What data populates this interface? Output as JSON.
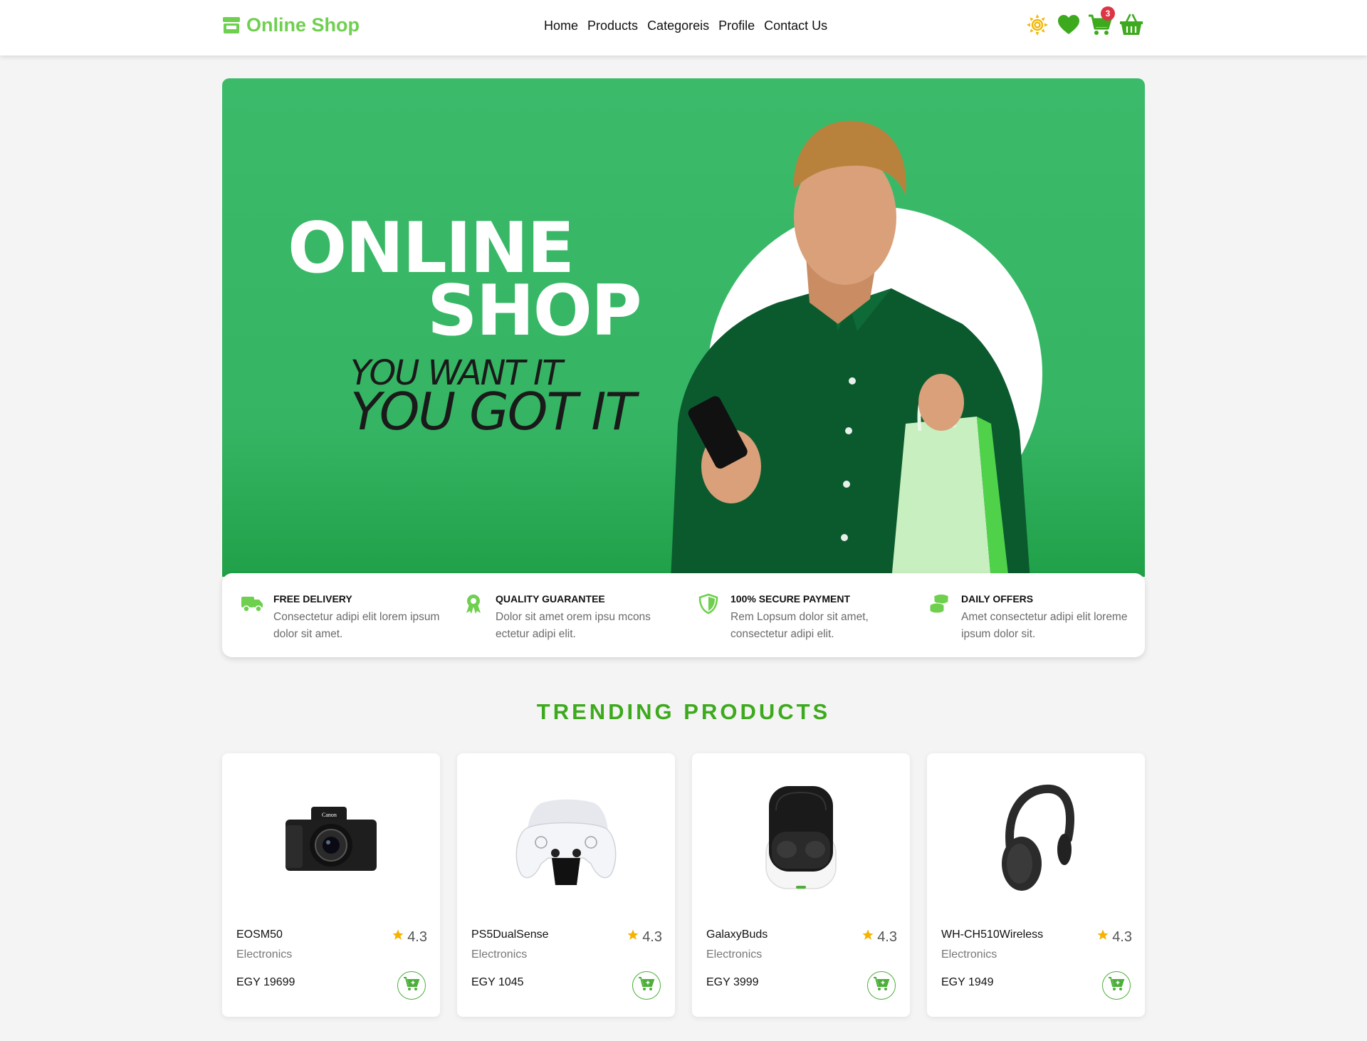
{
  "brand": {
    "name": "Online Shop",
    "color": "#6fcf4f",
    "icon": "store-icon"
  },
  "nav": {
    "links": [
      "Home",
      "Products",
      "Categoreis",
      "Profile",
      "Contact Us"
    ],
    "icons": {
      "theme": "sun-icon",
      "wishlist": "heart-icon",
      "cart": "cart-icon",
      "cart_count": "3",
      "basket": "basket-icon"
    }
  },
  "hero": {
    "title_line1": "ONLINE",
    "title_line2": "SHOP",
    "subtitle_line1": "YOU WANT IT",
    "subtitle_line2": "YOU GOT IT",
    "bg_color": "#3bbb6a"
  },
  "features": [
    {
      "icon": "truck-icon",
      "title": "FREE DELIVERY",
      "desc": "Consectetur adipi elit lorem ipsum dolor sit amet."
    },
    {
      "icon": "award-icon",
      "title": "QUALITY GUARANTEE",
      "desc": "Dolor sit amet orem ipsu mcons ectetur adipi elit."
    },
    {
      "icon": "shield-icon",
      "title": "100% SECURE PAYMENT",
      "desc": "Rem Lopsum dolor sit amet, consectetur adipi elit."
    },
    {
      "icon": "coins-icon",
      "title": "DAILY OFFERS",
      "desc": "Amet consectetur adipi elit loreme ipsum dolor sit."
    }
  ],
  "trending": {
    "title": "TRENDING PRODUCTS",
    "products": [
      {
        "name": "EOSM50",
        "category": "Electronics",
        "price": "EGY 19699",
        "rating": "4.3",
        "image": "camera"
      },
      {
        "name": "PS5DualSense",
        "category": "Electronics",
        "price": "EGY 1045",
        "rating": "4.3",
        "image": "controllers"
      },
      {
        "name": "GalaxyBuds",
        "category": "Electronics",
        "price": "EGY 3999",
        "rating": "4.3",
        "image": "earbuds"
      },
      {
        "name": "WH-CH510Wireless",
        "category": "Electronics",
        "price": "EGY 1949",
        "rating": "4.3",
        "image": "headphones"
      }
    ]
  },
  "colors": {
    "accent": "#3daa1d",
    "star": "#f5b301",
    "badge": "#dc3545"
  }
}
